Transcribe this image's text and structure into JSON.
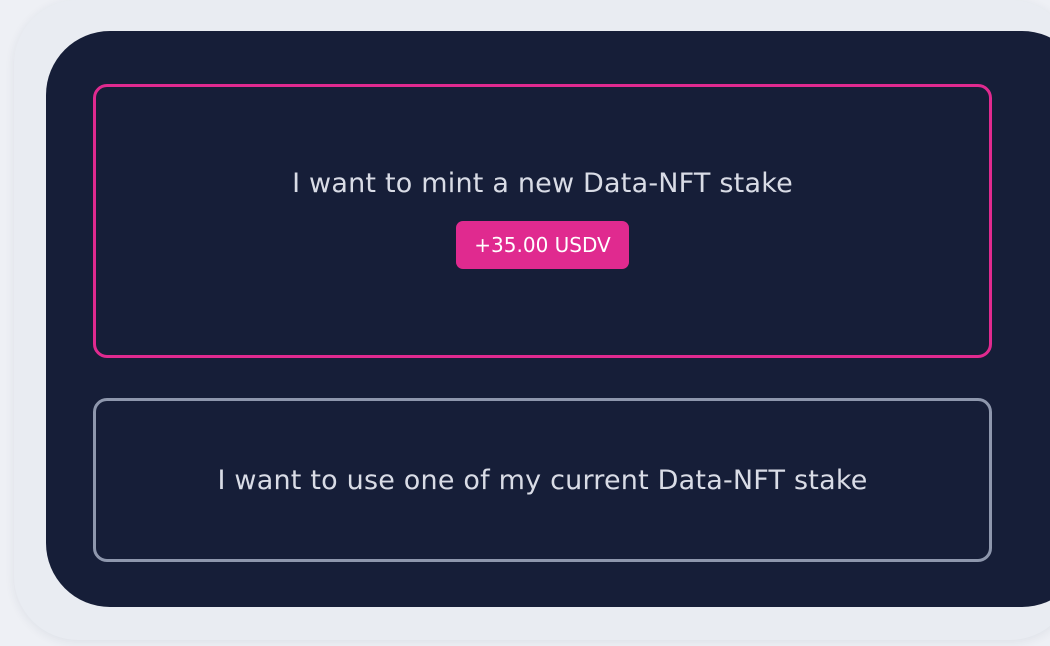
{
  "options": {
    "mint_new": {
      "label": "I want to mint a new Data-NFT stake",
      "badge": "+35.00 USDV",
      "selected": true
    },
    "use_current": {
      "label": "I want to use one of my current Data-NFT stake",
      "selected": false
    }
  },
  "colors": {
    "accent": "#e02a8f",
    "panel_background": "#161e38",
    "unselected_border": "#8e97ad",
    "text": "#d9dce6"
  }
}
